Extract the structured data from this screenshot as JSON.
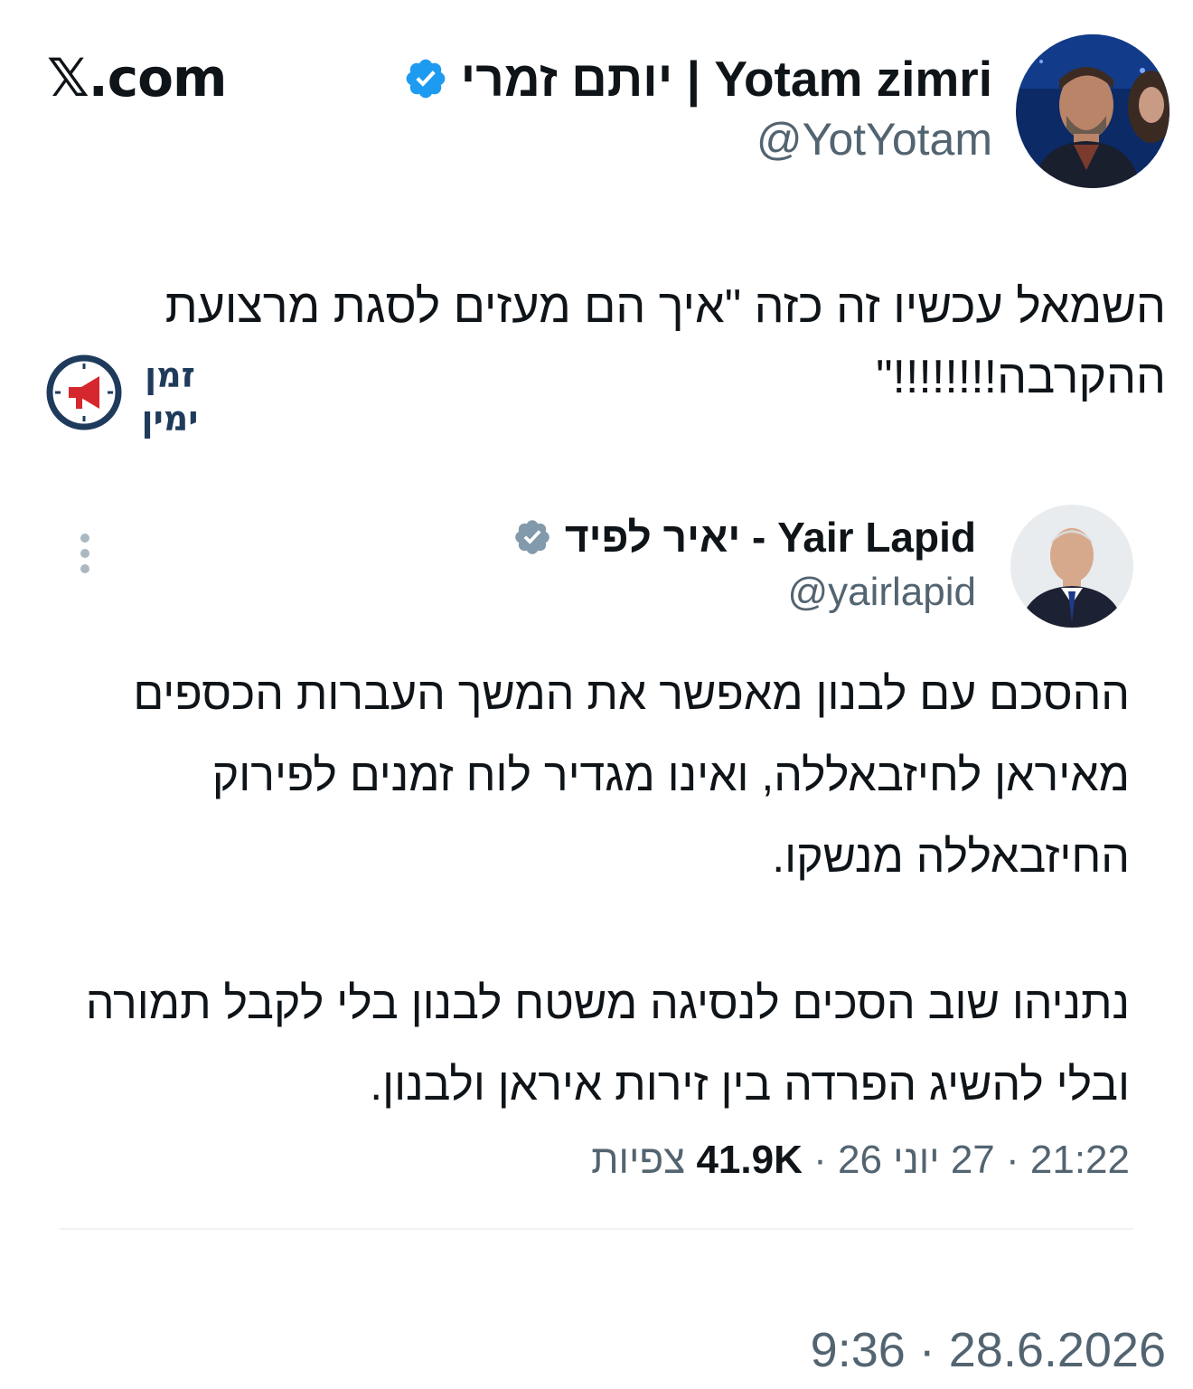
{
  "site": {
    "label": "𝕏.com"
  },
  "tweet": {
    "author_name": "יותם זמרי | Yotam zimri",
    "author_handle": "@YotYotam",
    "text": "השמאל עכשיו זה כזה \"איך הם מעזים לסגת מרצועת ההקרבה!!!!!!!!\"",
    "timestamp": "9:36 · 28.6.2026",
    "verified_color": "#1d9bf0"
  },
  "watermark": {
    "text_line1": "זמן",
    "text_line2": "ימין",
    "color": "#1f3b5c",
    "accent": "#d6262e"
  },
  "quote": {
    "author_name": "יאיר לפיד - Yair Lapid",
    "author_handle": "@yairlapid",
    "paragraph1": "ההסכם עם לבנון מאפשר את המשך העברות הכספים מאיראן לחיזבאללה, ואינו מגדיר לוח זמנים לפירוק החיזבאללה מנשקו.",
    "paragraph2": "נתניהו שוב הסכים לנסיגה משטח לבנון בלי לקבל תמורה ובלי להשיג הפרדה בין זירות איראן ולבנון.",
    "time": "21:22",
    "date": "27 יוני 26",
    "views_count": "41.9K",
    "views_label": "צפיות",
    "verified_color": "#829aab"
  }
}
